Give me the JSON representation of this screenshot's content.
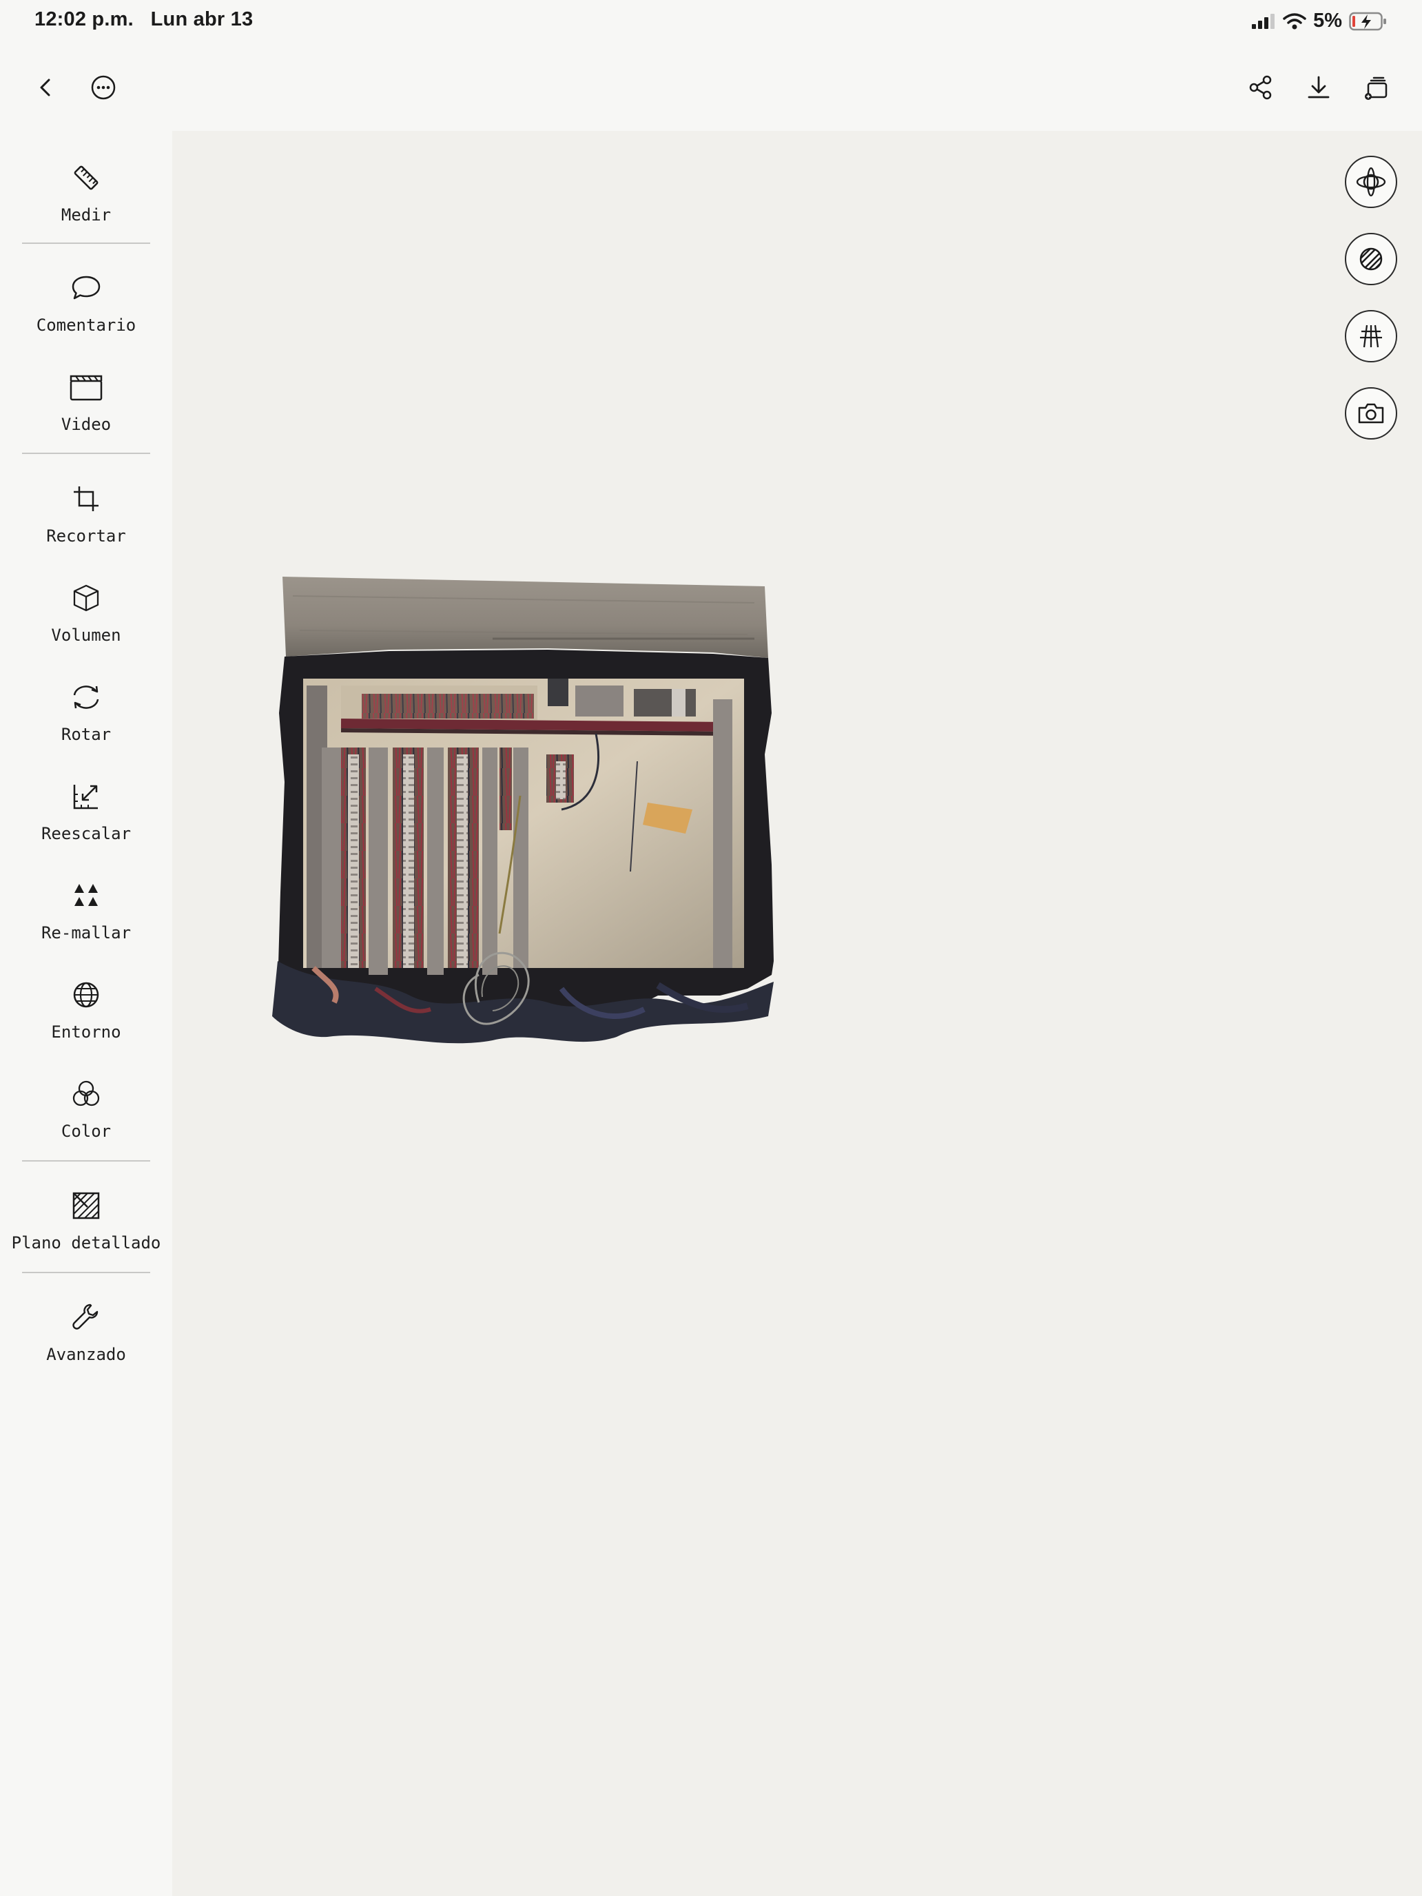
{
  "status_bar": {
    "time": "12:02 p.m.",
    "date": "Lun abr 13",
    "battery": "5%",
    "icons": [
      "signal-icon",
      "wifi-icon",
      "battery-charging-icon"
    ]
  },
  "toolbar": {
    "left": [
      "back-icon",
      "more-icon"
    ],
    "right": [
      "share-icon",
      "download-icon",
      "export-icon"
    ]
  },
  "sidebar": {
    "tools": [
      {
        "label": "Medir",
        "icon": "ruler-icon"
      },
      {
        "label": "Comentario",
        "icon": "comment-icon"
      },
      {
        "label": "Video",
        "icon": "video-clapper-icon"
      },
      {
        "label": "Recortar",
        "icon": "crop-icon"
      },
      {
        "label": "Volumen",
        "icon": "cube-icon"
      },
      {
        "label": "Rotar",
        "icon": "rotate-icon"
      },
      {
        "label": "Reescalar",
        "icon": "rescale-icon"
      },
      {
        "label": "Re-mallar",
        "icon": "remesh-icon"
      },
      {
        "label": "Entorno",
        "icon": "globe-icon"
      },
      {
        "label": "Color",
        "icon": "color-circles-icon"
      },
      {
        "label": "Plano detallado",
        "icon": "detailed-plan-icon"
      },
      {
        "label": "Avanzado",
        "icon": "wrench-icon"
      }
    ]
  },
  "view_controls": [
    "orbit-icon",
    "texture-icon",
    "grid-icon",
    "camera-icon"
  ],
  "colors": {
    "background": "#f7f7f5",
    "viewport": "#f1f0ec",
    "battery_low": "#e0443a"
  }
}
